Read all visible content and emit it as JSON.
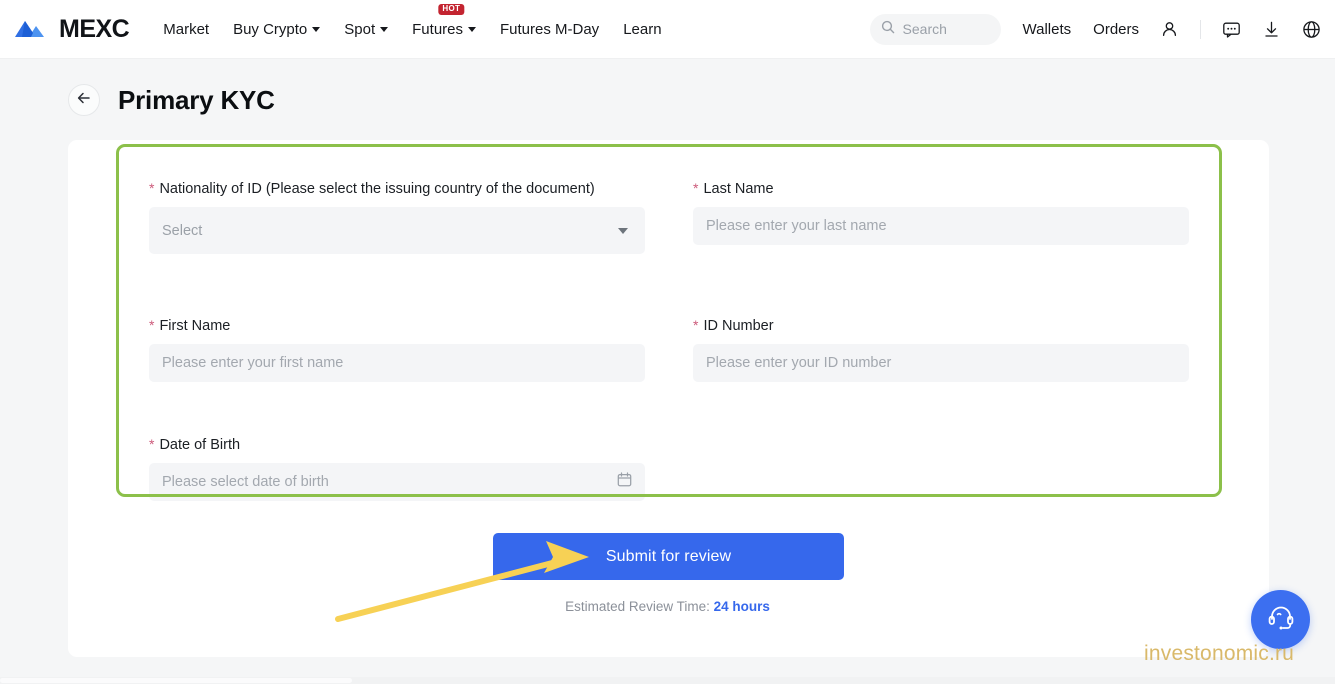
{
  "header": {
    "brand": "MEXC",
    "brand_logo_icon": "mexc-mountain-logo",
    "nav": [
      {
        "label": "Market",
        "has_caret": false,
        "badge": ""
      },
      {
        "label": "Buy Crypto",
        "has_caret": true,
        "badge": ""
      },
      {
        "label": "Spot",
        "has_caret": true,
        "badge": ""
      },
      {
        "label": "Futures",
        "has_caret": true,
        "badge": "HOT"
      },
      {
        "label": "Futures M-Day",
        "has_caret": false,
        "badge": ""
      },
      {
        "label": "Learn",
        "has_caret": false,
        "badge": ""
      }
    ],
    "search": {
      "placeholder": "Search",
      "icon": "search-icon"
    },
    "wallets_label": "Wallets",
    "orders_label": "Orders",
    "icons": [
      "user-icon",
      "chat-icon",
      "download-icon",
      "globe-icon"
    ]
  },
  "page": {
    "back_icon": "arrow-left-icon",
    "title": "Primary KYC"
  },
  "form": {
    "nationality": {
      "label": "Nationality of ID (Please select the issuing country of the document)",
      "required_marker": "*",
      "value": "Select",
      "caret_icon": "chevron-down-icon"
    },
    "last_name": {
      "label": "Last Name",
      "required_marker": "*",
      "placeholder": "Please enter your last name",
      "value": ""
    },
    "first_name": {
      "label": "First Name",
      "required_marker": "*",
      "placeholder": "Please enter your first name",
      "value": ""
    },
    "id_number": {
      "label": "ID Number",
      "required_marker": "*",
      "placeholder": "Please enter your ID number",
      "value": ""
    },
    "date_of_birth": {
      "label": "Date of Birth",
      "required_marker": "*",
      "placeholder": "Please select date of birth",
      "value": "",
      "calendar_icon": "calendar-icon"
    }
  },
  "submit": {
    "label": "Submit for review",
    "review_time_prefix": "Estimated Review Time: ",
    "review_time_value": "24 hours"
  },
  "support": {
    "icon": "headset-icon"
  },
  "watermark": {
    "text": "investonomic.ru"
  },
  "colors": {
    "primary_blue": "#3668ec",
    "annotation_green": "#8cc04a",
    "annotation_yellow": "#f7d155",
    "required_red": "#cc5a7a",
    "hot_badge_red": "#c32430",
    "page_bg": "#f5f6f7",
    "input_bg": "#f4f5f7",
    "watermark_gold": "#d9b96a"
  }
}
